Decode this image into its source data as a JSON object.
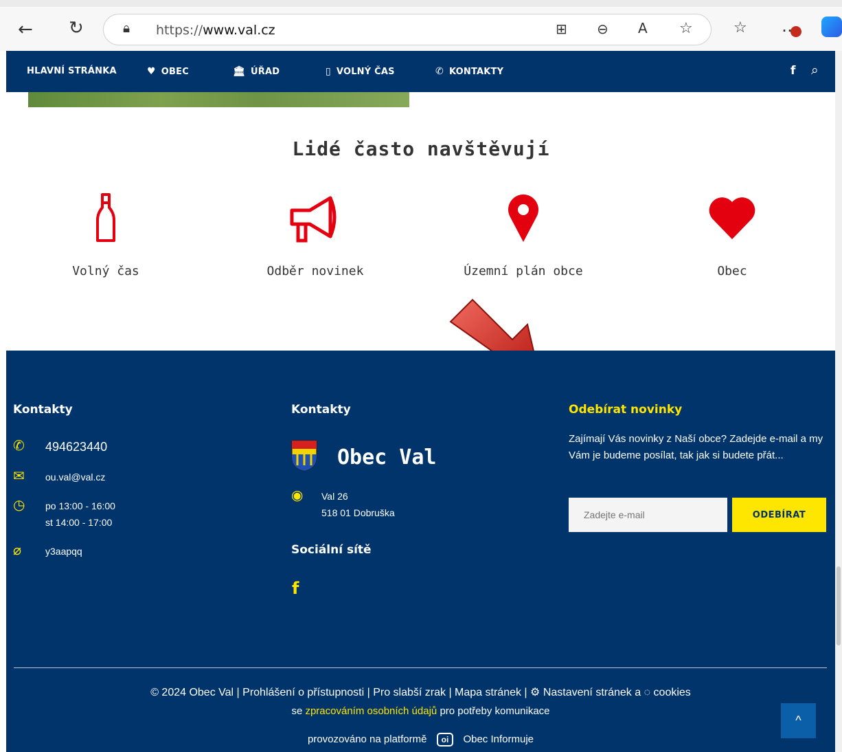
{
  "browser": {
    "url_prefix": "https://",
    "url_domain": "www.val.cz",
    "icons": [
      "back-arrow-icon",
      "refresh-icon",
      "site-info-icon",
      "app-available-icon",
      "zoom-out-icon",
      "read-aloud-icon",
      "favorite-icon",
      "favorites-list-icon",
      "more-options-icon",
      "copilot-icon"
    ]
  },
  "nav": {
    "items": [
      {
        "label": "HLAVNÍ STRÁNKA",
        "icon": ""
      },
      {
        "label": "OBEC",
        "icon": "heart-icon"
      },
      {
        "label": "ÚŘAD",
        "icon": "building-icon"
      },
      {
        "label": "VOLNÝ ČAS",
        "icon": "bottle-icon"
      },
      {
        "label": "KONTAKTY",
        "icon": "phone-icon"
      }
    ],
    "facebook": "f"
  },
  "visits": {
    "title": "Lidé často navštěvují",
    "items": [
      {
        "label": "Volný čas",
        "icon": "bottle-icon"
      },
      {
        "label": "Odběr novinek",
        "icon": "megaphone-icon"
      },
      {
        "label": "Územní plán obce",
        "icon": "map-pin-icon"
      },
      {
        "label": "Obec",
        "icon": "heart-icon"
      }
    ]
  },
  "footer": {
    "col1": {
      "title": "Kontakty",
      "phone": "494623440",
      "email": "ou.val@val.cz",
      "hours_line1": "po 13:00 - 16:00",
      "hours_line2": "st  14:00 - 17:00",
      "databox": "y3aapqq"
    },
    "col2": {
      "title": "Kontakty",
      "org_name": "Obec Val",
      "address_line1": "Val 26",
      "address_line2": "518 01 Dobruška",
      "social_title": "Sociální sítě",
      "social_fb": "f"
    },
    "col3": {
      "title": "Odebírat novinky",
      "text": "Zajímají Vás novinky z Naší obce? Zadejde e-mail a my Vám je budeme posílat, tak jak si budete přát...",
      "input_placeholder": "Zadejte e-mail",
      "button_label": "ODEBÍRAT"
    },
    "bottom": {
      "copyright": "© 2024 Obec Val",
      "link_accessibility": "Prohlášení o přístupnosti",
      "link_weak_sight": "Pro slabší zrak",
      "link_sitemap": "Mapa stránek",
      "link_settings": "Nastavení stránek a",
      "link_cookies": "cookies",
      "privacy_pre": "se",
      "privacy_link": "zpracováním osobních údajů",
      "privacy_post": "pro potřeby komunikace",
      "platform_text": "provozováno na platformě",
      "platform_badge": "oi",
      "platform_name": "Obec Informuje",
      "scroll_top": "^"
    }
  },
  "colors": {
    "navy": "#01346b",
    "accent_yellow": "#ffe600",
    "icon_red": "#e3000f"
  }
}
